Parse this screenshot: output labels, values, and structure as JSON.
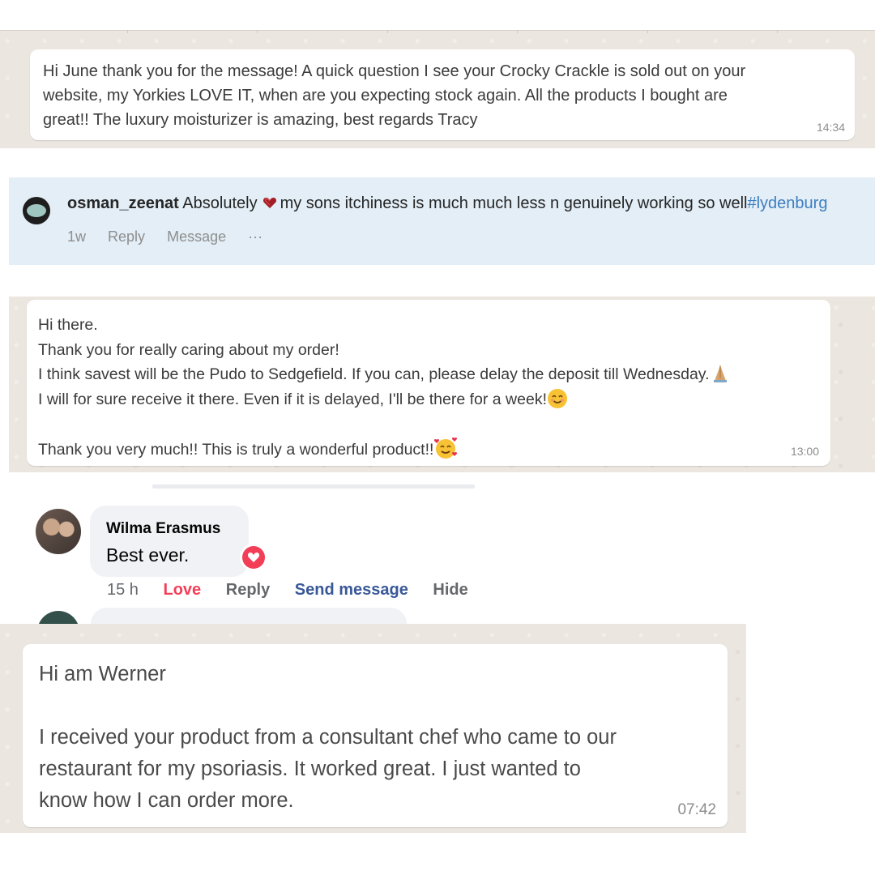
{
  "whatsapp_tracy": {
    "message": "Hi June thank you for the message!  A quick question I see your Crocky Crackle is sold out on your\nwebsite, my Yorkies LOVE IT, when are you expecting stock again. All the products I bought are\ngreat!! The luxury moisturizer is amazing, best regards Tracy",
    "time": "14:34"
  },
  "instagram_comment": {
    "username": "osman_zeenat",
    "text_before_emoji": "Absolutely",
    "emoji": "red-heart-stack-emoji",
    "text_after_emoji": "my sons itchiness is much much less n genuinely working so well",
    "hashtag": "#lydenburg",
    "age": "1w",
    "reply_label": "Reply",
    "message_label": "Message",
    "more_label": "···"
  },
  "whatsapp_sedgefield": {
    "line1": "Hi there.",
    "line2": "Thank you for really caring about my order!",
    "line3": "I think savest will be the Pudo to Sedgefield. If you can, please delay the deposit till Wednesday.",
    "line4": "I will for sure receive it there. Even if it is delayed, I'll be there for a week!",
    "line5": "Thank you very much!! This is truly a wonderful product!!",
    "emojis": [
      "folded-hands-emoji",
      "smiling-face-emoji",
      "smiling-face-with-hearts-emoji"
    ],
    "time": "13:00"
  },
  "facebook_comment": {
    "name": "Wilma Erasmus",
    "text": "Best ever.",
    "reaction": "love-reaction-icon",
    "time": "15 h",
    "love_label": "Love",
    "reply_label": "Reply",
    "send_message_label": "Send message",
    "hide_label": "Hide"
  },
  "whatsapp_werner": {
    "message": "Hi am Werner\n\nI received your product from a consultant chef who came to our\nrestaurant for my psoriasis. It worked great. I just wanted to\nknow how I can order more.",
    "time": "07:42"
  },
  "colors": {
    "whatsapp_bg": "#ebe6df",
    "instagram_bg": "#e3eef6",
    "hashtag": "#3d7ec1",
    "fb_love": "#f33e58",
    "fb_link": "#385898"
  }
}
